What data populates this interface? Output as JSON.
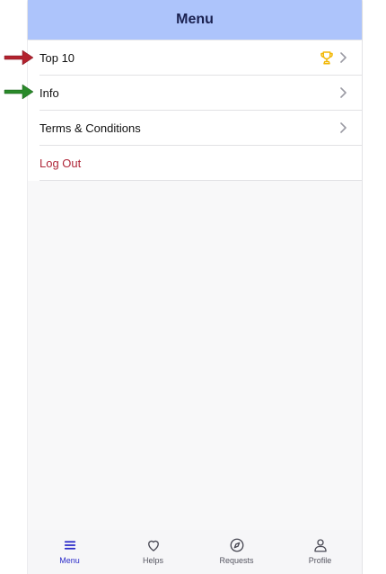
{
  "header": {
    "title": "Menu"
  },
  "menu": {
    "items": [
      {
        "label": "Top 10",
        "icon": "trophy-icon"
      },
      {
        "label": "Info"
      },
      {
        "label": "Terms & Conditions"
      },
      {
        "label": "Log Out"
      }
    ]
  },
  "tabbar": {
    "tabs": [
      {
        "label": "Menu",
        "icon": "menu-icon",
        "active": true
      },
      {
        "label": "Helps",
        "icon": "heart-icon"
      },
      {
        "label": "Requests",
        "icon": "navigation-icon"
      },
      {
        "label": "Profile",
        "icon": "user-icon"
      }
    ]
  },
  "colors": {
    "header_bg": "#adc4fb",
    "accent": "#2b2bc9",
    "logout": "#b0283a",
    "trophy": "#f2b705",
    "arrow_red": "#b3222e",
    "arrow_green": "#2a8a2a"
  }
}
